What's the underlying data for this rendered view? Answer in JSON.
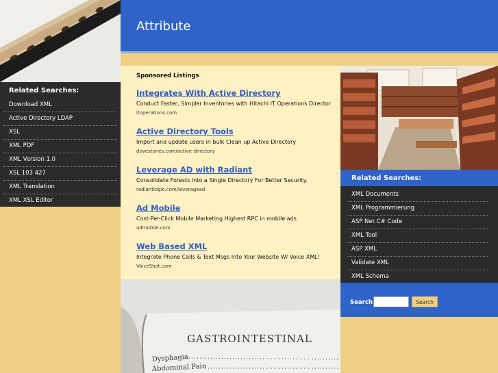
{
  "header": {
    "title": "Attribute"
  },
  "left_sidebar": {
    "title": "Related Searches:",
    "items": [
      "Download XML",
      "Active Directory LDAP",
      "XSL",
      "XML PDF",
      "XML Version 1.0",
      "XSL 103 427",
      "XML Translation",
      "XML XSL Editor"
    ]
  },
  "main": {
    "heading": "Sponsored Listings",
    "listings": [
      {
        "title": "Integrates With Active Directory",
        "desc": "Conduct Faster, Simpler Inventories with Hitachi IT Operations Director",
        "url": "itoperations.com"
      },
      {
        "title": "Active Directory Tools",
        "desc": "Import and update users in bulk Clean up Active Directory",
        "url": "dovestones.com/active-directory"
      },
      {
        "title": "Leverage AD with Radiant",
        "desc": "Consolidate Forests Into a Single Directory For Better Security.",
        "url": "radiantlogic.com/leveragead"
      },
      {
        "title": "Ad Mobile",
        "desc": "Cost-Per-Click Mobile Marketing Highest RPC in mobile ads",
        "url": "admobile.com"
      },
      {
        "title": "Web Based XML",
        "desc": "Integrate Phone Calls & Text Msgs Into Your Website W/ Voice XML!",
        "url": "VoiceShot.com"
      }
    ]
  },
  "book": {
    "heading": "GASTROINTESTINAL",
    "line1": "Dysphagia",
    "line2": "Abdominal Pain"
  },
  "right_sidebar": {
    "title": "Related Searches:",
    "items": [
      "XML Documents",
      "XML Programmierung",
      "ASP Net C# Code",
      "XML Tool",
      "ASP XML",
      "Validate XML",
      "XML Schema"
    ]
  },
  "search": {
    "label": "Search:",
    "button": "Search",
    "value": ""
  }
}
